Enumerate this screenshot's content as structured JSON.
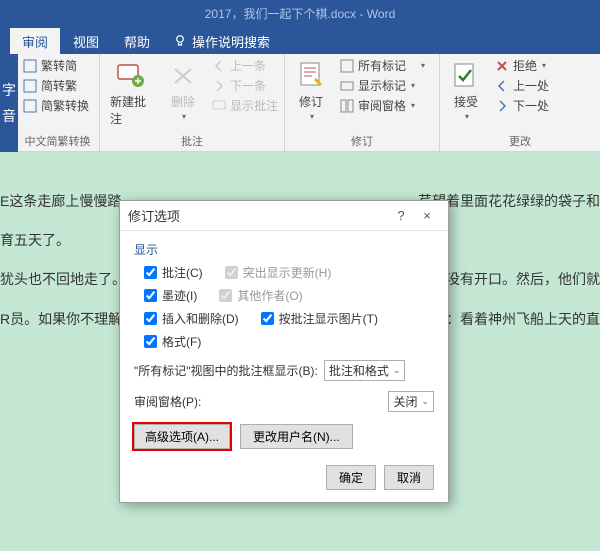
{
  "title": "2017，我们一起下个棋.docx - Word",
  "tabs": {
    "review": "审阅",
    "view": "视图",
    "help": "帮助",
    "search": "操作说明搜索"
  },
  "leftedge": {
    "char": "字",
    "label": "音"
  },
  "ribbon": {
    "chinese": {
      "items": [
        "繁转简",
        "简转繁",
        "简繁转换"
      ],
      "label": "中文简繁转换"
    },
    "comments": {
      "new": "新建批注",
      "del": "删除",
      "prev": "上一条",
      "next": "下一条",
      "show": "显示批注",
      "label": "批注"
    },
    "tracking": {
      "track": "修订",
      "all": "所有标记",
      "showmark": "显示标记",
      "pane": "审阅窗格",
      "label": "修订"
    },
    "changes": {
      "accept": "接受",
      "reject": "拒绝",
      "prev": "上一处",
      "next": "下一处",
      "label": "更改"
    }
  },
  "doc": {
    "l1": "E这条走廊上慢慢踏",
    "l2": "育五天了。",
    "l3": "犹头也不回地走了。",
    "l4": "R员。如果你不理解",
    "r1": "芹望着里面花花绿绿的袋子和",
    "r3": "最终没有开口。然后，他们就",
    "r4": "关系：看着神州飞船上天的直"
  },
  "dialog": {
    "title": "修订选项",
    "q": "?",
    "x": "×",
    "section": "显示",
    "ck": {
      "c": "批注(C)",
      "h": "突出显示更新(H)",
      "i": "墨迹(I)",
      "o": "其他作者(O)",
      "d": "插入和删除(D)",
      "t": "按批注显示图片(T)",
      "f": "格式(F)"
    },
    "markview_label": "\"所有标记\"视图中的批注框显示(B):",
    "markview_value": "批注和格式",
    "pane_label": "审阅窗格(P):",
    "pane_value": "关闭",
    "adv": "高级选项(A)...",
    "user": "更改用户名(N)...",
    "ok": "确定",
    "cancel": "取消"
  }
}
